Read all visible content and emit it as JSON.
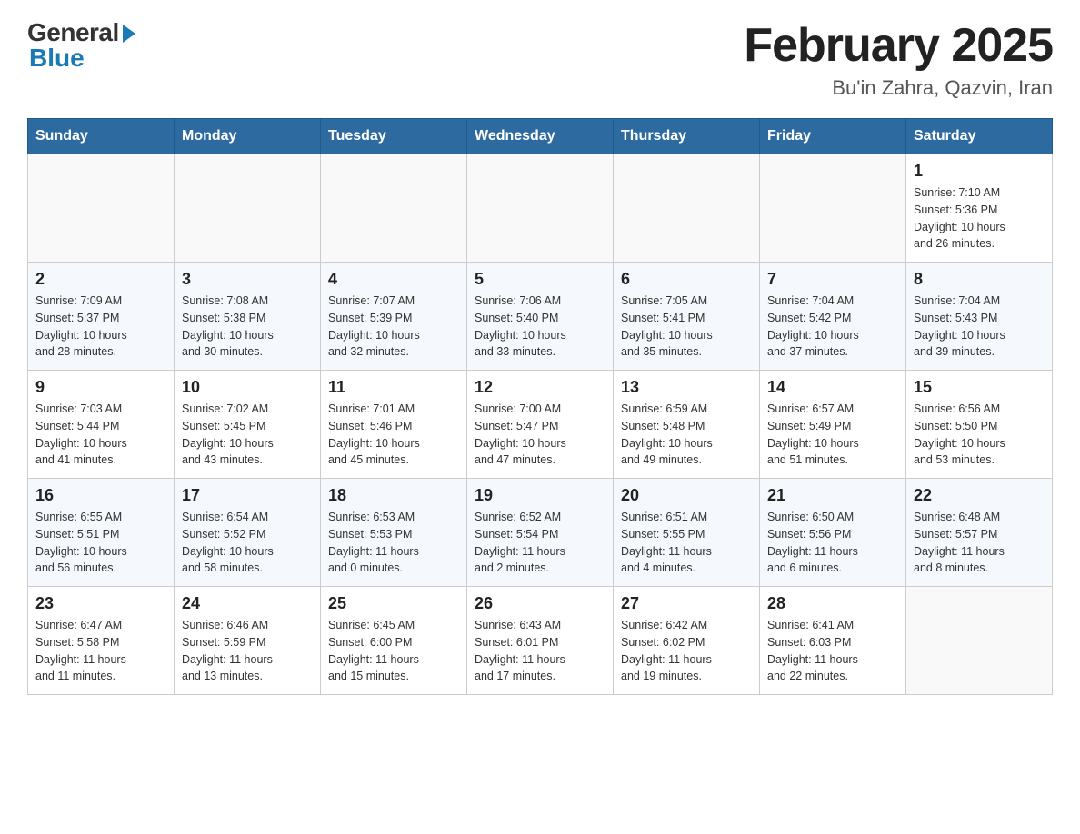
{
  "header": {
    "logo_general": "General",
    "logo_blue": "Blue",
    "month_title": "February 2025",
    "location": "Bu'in Zahra, Qazvin, Iran"
  },
  "weekdays": [
    "Sunday",
    "Monday",
    "Tuesday",
    "Wednesday",
    "Thursday",
    "Friday",
    "Saturday"
  ],
  "weeks": [
    [
      {
        "day": "",
        "info": ""
      },
      {
        "day": "",
        "info": ""
      },
      {
        "day": "",
        "info": ""
      },
      {
        "day": "",
        "info": ""
      },
      {
        "day": "",
        "info": ""
      },
      {
        "day": "",
        "info": ""
      },
      {
        "day": "1",
        "info": "Sunrise: 7:10 AM\nSunset: 5:36 PM\nDaylight: 10 hours\nand 26 minutes."
      }
    ],
    [
      {
        "day": "2",
        "info": "Sunrise: 7:09 AM\nSunset: 5:37 PM\nDaylight: 10 hours\nand 28 minutes."
      },
      {
        "day": "3",
        "info": "Sunrise: 7:08 AM\nSunset: 5:38 PM\nDaylight: 10 hours\nand 30 minutes."
      },
      {
        "day": "4",
        "info": "Sunrise: 7:07 AM\nSunset: 5:39 PM\nDaylight: 10 hours\nand 32 minutes."
      },
      {
        "day": "5",
        "info": "Sunrise: 7:06 AM\nSunset: 5:40 PM\nDaylight: 10 hours\nand 33 minutes."
      },
      {
        "day": "6",
        "info": "Sunrise: 7:05 AM\nSunset: 5:41 PM\nDaylight: 10 hours\nand 35 minutes."
      },
      {
        "day": "7",
        "info": "Sunrise: 7:04 AM\nSunset: 5:42 PM\nDaylight: 10 hours\nand 37 minutes."
      },
      {
        "day": "8",
        "info": "Sunrise: 7:04 AM\nSunset: 5:43 PM\nDaylight: 10 hours\nand 39 minutes."
      }
    ],
    [
      {
        "day": "9",
        "info": "Sunrise: 7:03 AM\nSunset: 5:44 PM\nDaylight: 10 hours\nand 41 minutes."
      },
      {
        "day": "10",
        "info": "Sunrise: 7:02 AM\nSunset: 5:45 PM\nDaylight: 10 hours\nand 43 minutes."
      },
      {
        "day": "11",
        "info": "Sunrise: 7:01 AM\nSunset: 5:46 PM\nDaylight: 10 hours\nand 45 minutes."
      },
      {
        "day": "12",
        "info": "Sunrise: 7:00 AM\nSunset: 5:47 PM\nDaylight: 10 hours\nand 47 minutes."
      },
      {
        "day": "13",
        "info": "Sunrise: 6:59 AM\nSunset: 5:48 PM\nDaylight: 10 hours\nand 49 minutes."
      },
      {
        "day": "14",
        "info": "Sunrise: 6:57 AM\nSunset: 5:49 PM\nDaylight: 10 hours\nand 51 minutes."
      },
      {
        "day": "15",
        "info": "Sunrise: 6:56 AM\nSunset: 5:50 PM\nDaylight: 10 hours\nand 53 minutes."
      }
    ],
    [
      {
        "day": "16",
        "info": "Sunrise: 6:55 AM\nSunset: 5:51 PM\nDaylight: 10 hours\nand 56 minutes."
      },
      {
        "day": "17",
        "info": "Sunrise: 6:54 AM\nSunset: 5:52 PM\nDaylight: 10 hours\nand 58 minutes."
      },
      {
        "day": "18",
        "info": "Sunrise: 6:53 AM\nSunset: 5:53 PM\nDaylight: 11 hours\nand 0 minutes."
      },
      {
        "day": "19",
        "info": "Sunrise: 6:52 AM\nSunset: 5:54 PM\nDaylight: 11 hours\nand 2 minutes."
      },
      {
        "day": "20",
        "info": "Sunrise: 6:51 AM\nSunset: 5:55 PM\nDaylight: 11 hours\nand 4 minutes."
      },
      {
        "day": "21",
        "info": "Sunrise: 6:50 AM\nSunset: 5:56 PM\nDaylight: 11 hours\nand 6 minutes."
      },
      {
        "day": "22",
        "info": "Sunrise: 6:48 AM\nSunset: 5:57 PM\nDaylight: 11 hours\nand 8 minutes."
      }
    ],
    [
      {
        "day": "23",
        "info": "Sunrise: 6:47 AM\nSunset: 5:58 PM\nDaylight: 11 hours\nand 11 minutes."
      },
      {
        "day": "24",
        "info": "Sunrise: 6:46 AM\nSunset: 5:59 PM\nDaylight: 11 hours\nand 13 minutes."
      },
      {
        "day": "25",
        "info": "Sunrise: 6:45 AM\nSunset: 6:00 PM\nDaylight: 11 hours\nand 15 minutes."
      },
      {
        "day": "26",
        "info": "Sunrise: 6:43 AM\nSunset: 6:01 PM\nDaylight: 11 hours\nand 17 minutes."
      },
      {
        "day": "27",
        "info": "Sunrise: 6:42 AM\nSunset: 6:02 PM\nDaylight: 11 hours\nand 19 minutes."
      },
      {
        "day": "28",
        "info": "Sunrise: 6:41 AM\nSunset: 6:03 PM\nDaylight: 11 hours\nand 22 minutes."
      },
      {
        "day": "",
        "info": ""
      }
    ]
  ]
}
